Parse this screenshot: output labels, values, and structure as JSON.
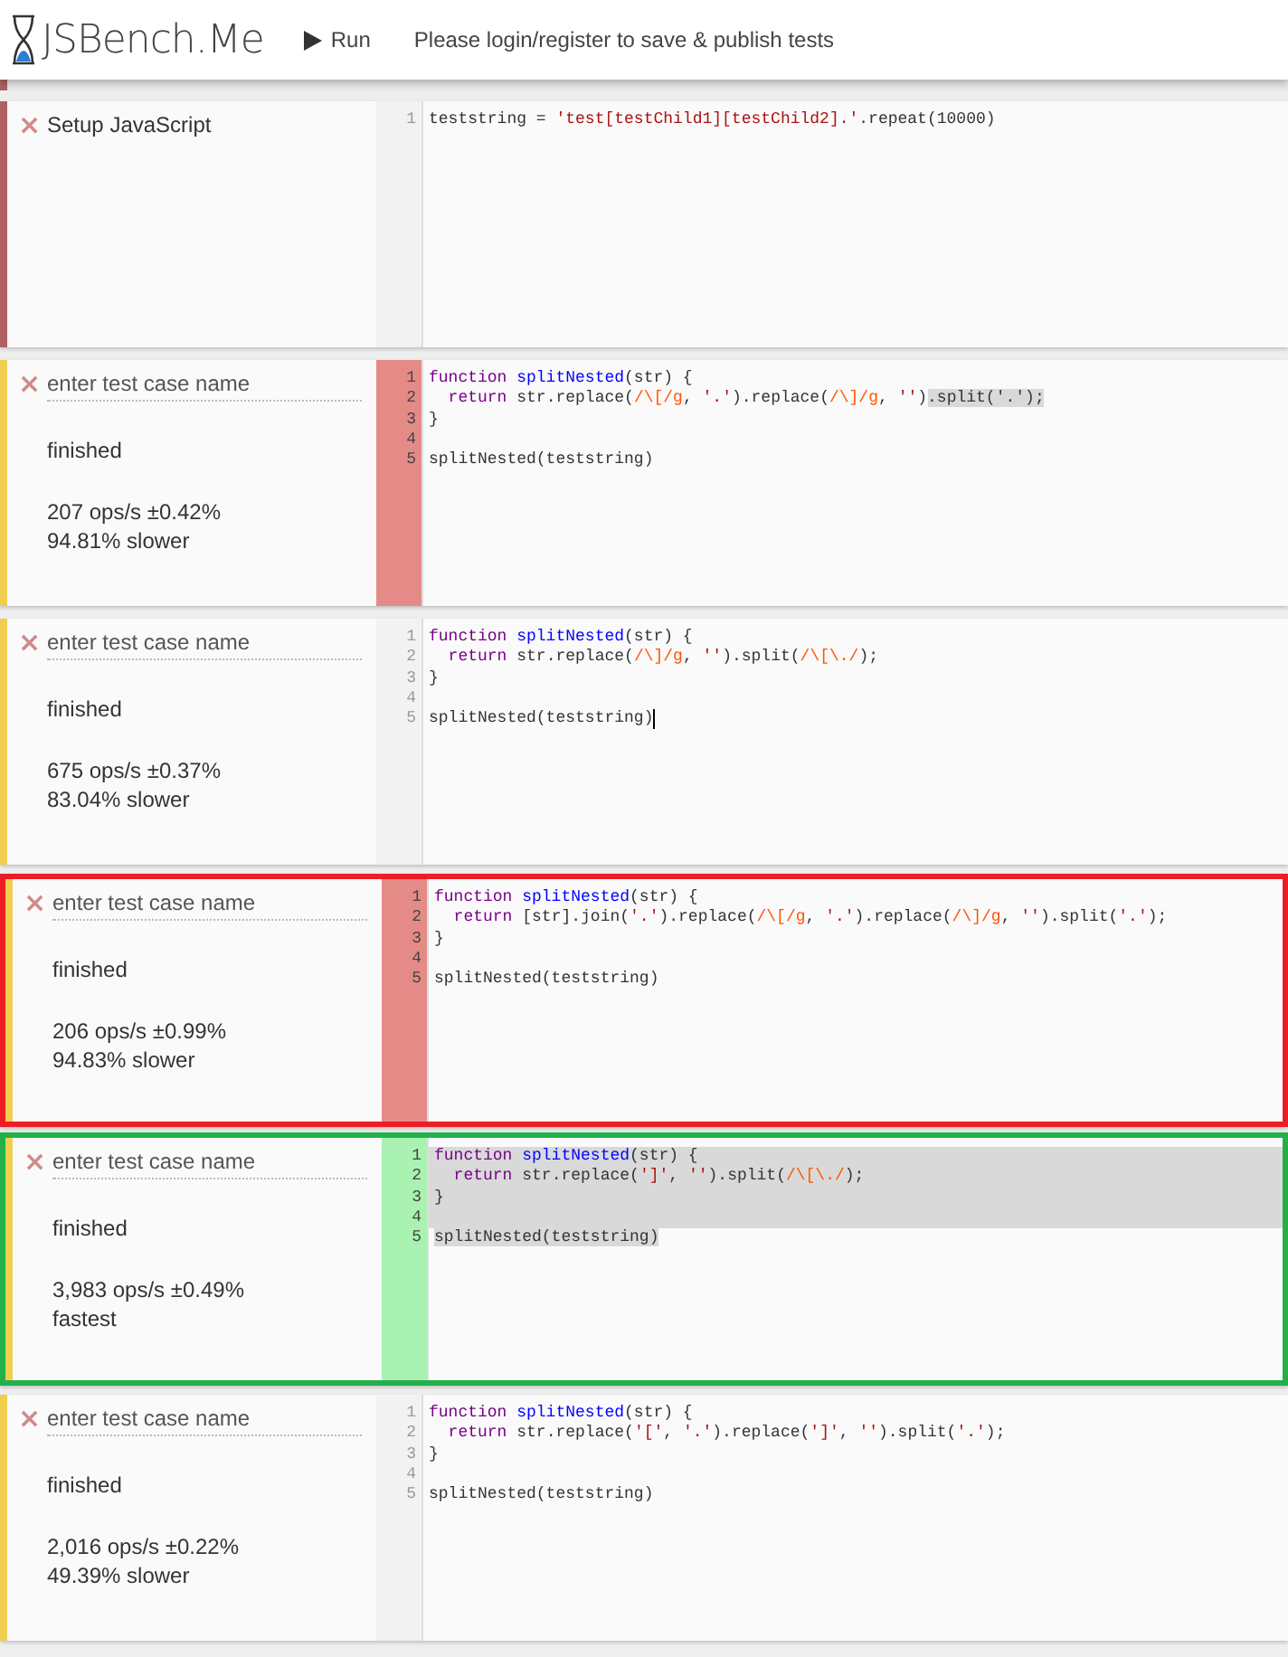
{
  "header": {
    "logo": "JSBench.Me",
    "run_button": "Run",
    "notice": "Please login/register to save & publish tests"
  },
  "setup": {
    "title": "Setup JavaScript",
    "delete": "×",
    "lines": [
      {
        "number": "1",
        "tokens": [
          {
            "text": "teststring = ",
            "kind": "plain"
          },
          {
            "text": "'test[testChild1][testChild2].'",
            "kind": "string"
          },
          {
            "text": ".repeat(10000)",
            "kind": "plain"
          }
        ]
      }
    ]
  },
  "cases": [
    {
      "delete": "×",
      "name_placeholder": "enter test case name",
      "status": "finished",
      "ops": "207 ops/s ±0.42%",
      "comparison": "94.81% slower",
      "slow": true,
      "slowest": false,
      "fastest": false,
      "lines": [
        {
          "number": "1",
          "tokens": [
            {
              "text": "function ",
              "kind": "keyword"
            },
            {
              "text": "splitNested",
              "kind": "def"
            },
            {
              "text": "(str) {",
              "kind": "plain"
            }
          ]
        },
        {
          "number": "2",
          "tokens": [
            {
              "text": "  return",
              "kind": "keyword"
            },
            {
              "text": " str.replace(",
              "kind": "plain"
            },
            {
              "text": "/\\[/g",
              "kind": "regex"
            },
            {
              "text": ", ",
              "kind": "plain"
            },
            {
              "text": "'.'",
              "kind": "string"
            },
            {
              "text": ").replace(",
              "kind": "plain"
            },
            {
              "text": "/\\]/g",
              "kind": "regex"
            },
            {
              "text": ", ",
              "kind": "plain"
            },
            {
              "text": "''",
              "kind": "string"
            },
            {
              "text": ")",
              "kind": "plain"
            },
            {
              "text": ".split('.');",
              "kind": "selected"
            }
          ]
        },
        {
          "number": "3",
          "tokens": [
            {
              "text": "}",
              "kind": "plain"
            }
          ]
        },
        {
          "number": "4"
        },
        {
          "number": "5",
          "tokens": [
            {
              "text": "splitNested(teststring)",
              "kind": "plain"
            }
          ]
        }
      ]
    },
    {
      "delete": "×",
      "name_placeholder": "enter test case name",
      "status": "finished",
      "ops": "675 ops/s ±0.37%",
      "comparison": "83.04% slower",
      "slow": false,
      "slowest": false,
      "fastest": false,
      "lines": [
        {
          "number": "1",
          "tokens": [
            {
              "text": "function ",
              "kind": "keyword"
            },
            {
              "text": "splitNested",
              "kind": "def"
            },
            {
              "text": "(str) {",
              "kind": "plain"
            }
          ]
        },
        {
          "number": "2",
          "tokens": [
            {
              "text": "  return",
              "kind": "keyword"
            },
            {
              "text": " str.replace(",
              "kind": "plain"
            },
            {
              "text": "/\\]/g",
              "kind": "regex"
            },
            {
              "text": ", ",
              "kind": "plain"
            },
            {
              "text": "''",
              "kind": "string"
            },
            {
              "text": ").split(",
              "kind": "plain"
            },
            {
              "text": "/\\[\\./",
              "kind": "regex"
            },
            {
              "text": ");",
              "kind": "plain"
            }
          ]
        },
        {
          "number": "3",
          "tokens": [
            {
              "text": "}",
              "kind": "plain"
            }
          ]
        },
        {
          "number": "4"
        },
        {
          "number": "5",
          "cursor": true,
          "tokens": [
            {
              "text": "splitNested(teststring)",
              "kind": "plain"
            }
          ]
        }
      ]
    },
    {
      "delete": "×",
      "name_placeholder": "enter test case name",
      "status": "finished",
      "ops": "206 ops/s ±0.99%",
      "comparison": "94.83% slower",
      "slow": true,
      "slowest": true,
      "fastest": false,
      "lines": [
        {
          "number": "1",
          "tokens": [
            {
              "text": "function ",
              "kind": "keyword"
            },
            {
              "text": "splitNested",
              "kind": "def"
            },
            {
              "text": "(str) {",
              "kind": "plain"
            }
          ]
        },
        {
          "number": "2",
          "tokens": [
            {
              "text": "  return",
              "kind": "keyword"
            },
            {
              "text": " [str].join(",
              "kind": "plain"
            },
            {
              "text": "'.'",
              "kind": "string"
            },
            {
              "text": ").replace(",
              "kind": "plain"
            },
            {
              "text": "/\\[/g",
              "kind": "regex"
            },
            {
              "text": ", ",
              "kind": "plain"
            },
            {
              "text": "'.'",
              "kind": "string"
            },
            {
              "text": ").replace(",
              "kind": "plain"
            },
            {
              "text": "/\\]/g",
              "kind": "regex"
            },
            {
              "text": ", ",
              "kind": "plain"
            },
            {
              "text": "''",
              "kind": "string"
            },
            {
              "text": ").split(",
              "kind": "plain"
            },
            {
              "text": "'.'",
              "kind": "string"
            },
            {
              "text": ");",
              "kind": "plain"
            }
          ]
        },
        {
          "number": "3",
          "tokens": [
            {
              "text": "}",
              "kind": "plain"
            }
          ]
        },
        {
          "number": "4"
        },
        {
          "number": "5",
          "tokens": [
            {
              "text": "splitNested(teststring)",
              "kind": "plain"
            }
          ]
        }
      ]
    },
    {
      "delete": "×",
      "name_placeholder": "enter test case name",
      "status": "finished",
      "ops": "3,983 ops/s ±0.49%",
      "comparison": "fastest",
      "slow": false,
      "slowest": false,
      "fastest": true,
      "lines": [
        {
          "number": "1",
          "selected": true,
          "tokens": [
            {
              "text": "function ",
              "kind": "keyword"
            },
            {
              "text": "splitNested",
              "kind": "def"
            },
            {
              "text": "(str) {",
              "kind": "plain"
            }
          ]
        },
        {
          "number": "2",
          "selected": true,
          "tokens": [
            {
              "text": "  return",
              "kind": "keyword"
            },
            {
              "text": " str.replace(",
              "kind": "plain"
            },
            {
              "text": "']'",
              "kind": "string"
            },
            {
              "text": ", ",
              "kind": "plain"
            },
            {
              "text": "''",
              "kind": "string"
            },
            {
              "text": ").split(",
              "kind": "plain"
            },
            {
              "text": "/\\[\\./",
              "kind": "regex"
            },
            {
              "text": ");",
              "kind": "plain"
            }
          ]
        },
        {
          "number": "3",
          "selected": true,
          "tokens": [
            {
              "text": "}",
              "kind": "plain"
            }
          ]
        },
        {
          "number": "4",
          "selected": true
        },
        {
          "number": "5",
          "tokens": [
            {
              "text": "splitNested(teststring)",
              "kind": "selected"
            }
          ]
        }
      ]
    },
    {
      "delete": "×",
      "name_placeholder": "enter test case name",
      "status": "finished",
      "ops": "2,016 ops/s ±0.22%",
      "comparison": "49.39% slower",
      "slow": false,
      "slowest": false,
      "fastest": false,
      "lines": [
        {
          "number": "1",
          "tokens": [
            {
              "text": "function ",
              "kind": "keyword"
            },
            {
              "text": "splitNested",
              "kind": "def"
            },
            {
              "text": "(str) {",
              "kind": "plain"
            }
          ]
        },
        {
          "number": "2",
          "tokens": [
            {
              "text": "  return",
              "kind": "keyword"
            },
            {
              "text": " str.replace(",
              "kind": "plain"
            },
            {
              "text": "'['",
              "kind": "string"
            },
            {
              "text": ", ",
              "kind": "plain"
            },
            {
              "text": "'.'",
              "kind": "string"
            },
            {
              "text": ").replace(",
              "kind": "plain"
            },
            {
              "text": "']'",
              "kind": "string"
            },
            {
              "text": ", ",
              "kind": "plain"
            },
            {
              "text": "''",
              "kind": "string"
            },
            {
              "text": ").split(",
              "kind": "plain"
            },
            {
              "text": "'.'",
              "kind": "string"
            },
            {
              "text": ");",
              "kind": "plain"
            }
          ]
        },
        {
          "number": "3",
          "tokens": [
            {
              "text": "}",
              "kind": "plain"
            }
          ]
        },
        {
          "number": "4"
        },
        {
          "number": "5",
          "tokens": [
            {
              "text": "splitNested(teststring)",
              "kind": "plain"
            }
          ]
        }
      ]
    }
  ]
}
